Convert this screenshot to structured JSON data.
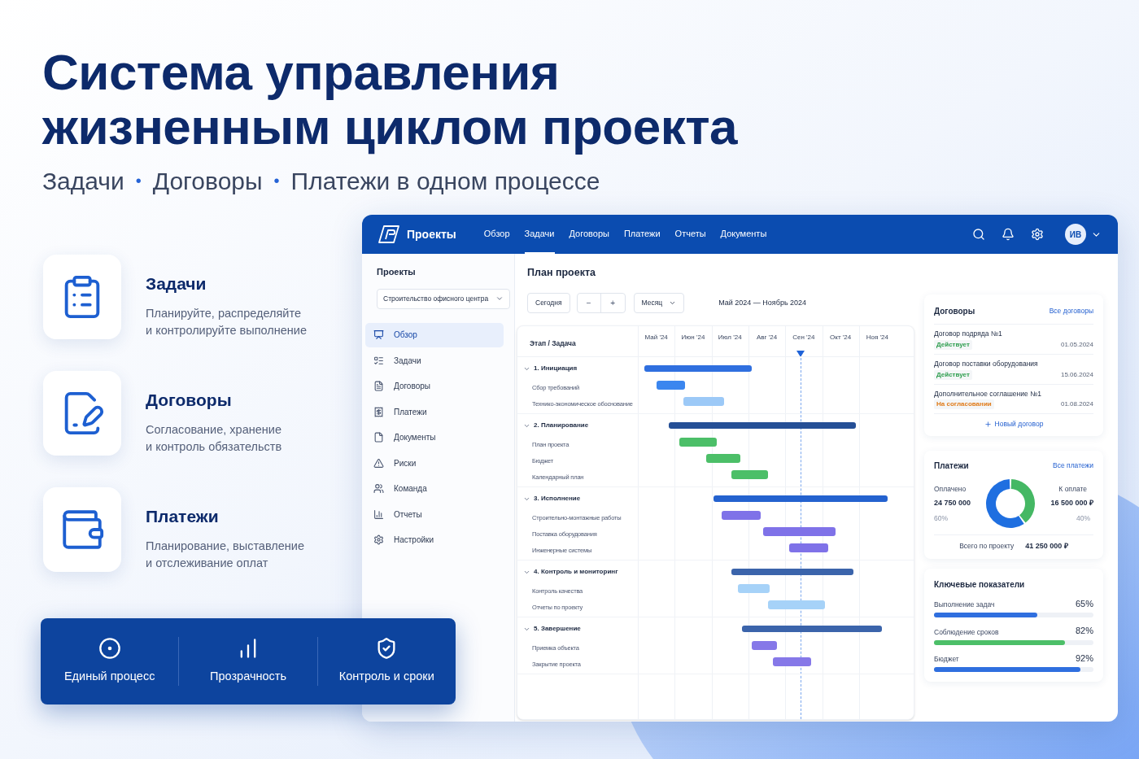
{
  "headline": {
    "lines": [
      "Система управления",
      "жизненным циклом проекта"
    ]
  },
  "subtitle": [
    {
      "kind": "text",
      "text": "Задачи"
    },
    {
      "kind": "separator",
      "text": "•"
    },
    {
      "kind": "text",
      "text": "Договоры"
    },
    {
      "kind": "separator",
      "text": "•"
    },
    {
      "kind": "text",
      "text": "Платежи в одном процессе"
    }
  ],
  "features": [
    {
      "title": "Задачи",
      "description": [
        "Планируйте, распределяйте",
        "и контролируйте выполнение"
      ]
    },
    {
      "title": "Договоры",
      "description": [
        "Согласование, хранение",
        "и контроль обязательств"
      ]
    },
    {
      "title": "Платежи",
      "description": [
        "Планирование, выставление",
        "и отслеживание оплат"
      ]
    }
  ],
  "banner": [
    {
      "label": "Единый процесс"
    },
    {
      "label": "Прозрачность"
    },
    {
      "label": "Контроль и сроки"
    }
  ],
  "app": {
    "brand": "Проекты",
    "nav": [
      {
        "label": "Обзор",
        "selected": false
      },
      {
        "label": "Задачи",
        "selected": true
      },
      {
        "label": "Договоры",
        "selected": false
      },
      {
        "label": "Платежи",
        "selected": false
      },
      {
        "label": "Отчеты",
        "selected": false
      },
      {
        "label": "Документы",
        "selected": false
      }
    ],
    "user_initials": "ИВ",
    "sidebar": {
      "title": "Проекты",
      "project_select": "Строительство офисного центра",
      "items": [
        {
          "label": "Обзор",
          "selected": true
        },
        {
          "label": "Задачи",
          "selected": false
        },
        {
          "label": "Договоры",
          "selected": false
        },
        {
          "label": "Платежи",
          "selected": false
        },
        {
          "label": "Документы",
          "selected": false
        },
        {
          "label": "Риски",
          "selected": false
        },
        {
          "label": "Команда",
          "selected": false
        },
        {
          "label": "Отчеты",
          "selected": false
        },
        {
          "label": "Настройки",
          "selected": false
        }
      ]
    },
    "main": {
      "title": "План проекта",
      "today_button": "Сегодня",
      "zoom_out": "−",
      "zoom_in": "+",
      "scale_select": "Месяц",
      "date_range": "Май 2024 — Ноябрь 2024"
    },
    "gantt": {
      "column_header": "Этап / Задача",
      "months": [
        "Май '24",
        "Июн '24",
        "Июл '24",
        "Авг '24",
        "Сен '24",
        "Окт '24",
        "Ноя '24"
      ],
      "phases": [
        {
          "title": "1. Инициация",
          "expanded": true,
          "color": "#2f6fdf",
          "tasks": [
            {
              "name": "Сбор требований",
              "color": "#3b86ef"
            },
            {
              "name": "Технико-экономическое обоснование",
              "color": "#9cc9f7"
            }
          ]
        },
        {
          "title": "2. Планирование",
          "expanded": true,
          "color": "#254f96",
          "tasks": [
            {
              "name": "План проекта",
              "color": "#4cbf68"
            },
            {
              "name": "Бюджет",
              "color": "#4cbf68"
            },
            {
              "name": "Календарный план",
              "color": "#4cbf68"
            }
          ]
        },
        {
          "title": "3. Исполнение",
          "expanded": true,
          "color": "#2462cf",
          "tasks": [
            {
              "name": "Строительно-монтажные работы",
              "color": "#7f72e8"
            },
            {
              "name": "Поставка оборудования",
              "color": "#7f72e8"
            },
            {
              "name": "Инженерные системы",
              "color": "#7f72e8"
            }
          ]
        },
        {
          "title": "4. Контроль и мониторинг",
          "expanded": true,
          "color": "#3b64ab",
          "tasks": [
            {
              "name": "Контроль качества",
              "color": "#a6d2f8"
            },
            {
              "name": "Отчеты по проекту",
              "color": "#a6d2f8"
            }
          ]
        },
        {
          "title": "5. Завершение",
          "expanded": true,
          "color": "#3b64ab",
          "tasks": [
            {
              "name": "Приемка объекта",
              "color": "#8678e8"
            },
            {
              "name": "Закрытие проекта",
              "color": "#8678e8"
            }
          ]
        }
      ]
    },
    "contracts": {
      "title": "Договоры",
      "link": "Все договоры",
      "items": [
        {
          "name": "Договор подряда №1",
          "status": "Действует",
          "color": "#2e9e4f",
          "date": "01.05.2024"
        },
        {
          "name": "Договор поставки оборудования",
          "status": "Действует",
          "color": "#2e9e4f",
          "date": "15.06.2024"
        },
        {
          "name": "Дополнительное соглашение №1",
          "status": "На согласовании",
          "color": "#e07b1a",
          "date": "01.08.2024"
        }
      ],
      "new_button": "Новый договор"
    },
    "payments": {
      "title": "Платежи",
      "link": "Все платежи",
      "paid": {
        "amount": "24 750 000",
        "share": "60%"
      },
      "due": {
        "amount": "16 500 000 ₽",
        "share": "40%"
      },
      "chart_data": {
        "type": "donut",
        "categories": [
          "Оплачено",
          "К оплате"
        ],
        "values": [
          60,
          40
        ]
      },
      "total_label": "Всего по проекту",
      "total": "41 250 000 ₽"
    },
    "kpi": {
      "title": "Ключевые показатели",
      "items": [
        {
          "label": "Выполнение задач",
          "value": "65%",
          "level": 0.65,
          "color": "#2f6fdf"
        },
        {
          "label": "Соблюдение сроков",
          "value": "82%",
          "level": 0.82,
          "color": "#4cbf68"
        },
        {
          "label": "Бюджет",
          "value": "92%",
          "level": 0.92,
          "color": "#2f6fdf"
        }
      ]
    }
  }
}
